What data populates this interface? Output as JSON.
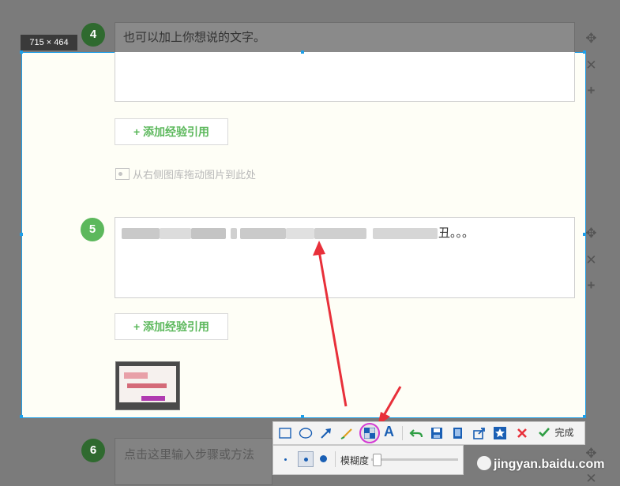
{
  "capture_size_label": "715 × 464",
  "steps": [
    {
      "number": "4",
      "text": "也可以加上你想说的文字。"
    },
    {
      "number": "5",
      "text_visible_end": "丑。。。"
    },
    {
      "number": "6",
      "placeholder": "点击这里输入步骤或方法"
    }
  ],
  "add_reference_label": "+ 添加经验引用",
  "drag_hint": "从右侧图库拖动图片到此处",
  "toolbar": {
    "done_label": "完成",
    "blur_label": "模糊度",
    "tools": [
      "rectangle-icon",
      "ellipse-icon",
      "arrow-icon",
      "brush-icon",
      "mosaic-icon",
      "text-icon",
      "undo-icon",
      "save-icon",
      "copy-icon",
      "share-icon",
      "favorite-icon",
      "cancel-icon",
      "confirm-icon"
    ]
  },
  "watermark": "jingyan.baidu.com",
  "colors": {
    "selection_border": "#1e9fe8",
    "step_green": "#5cb85c",
    "arrow_red": "#e8303a",
    "highlight_magenta": "#d43ad4"
  }
}
